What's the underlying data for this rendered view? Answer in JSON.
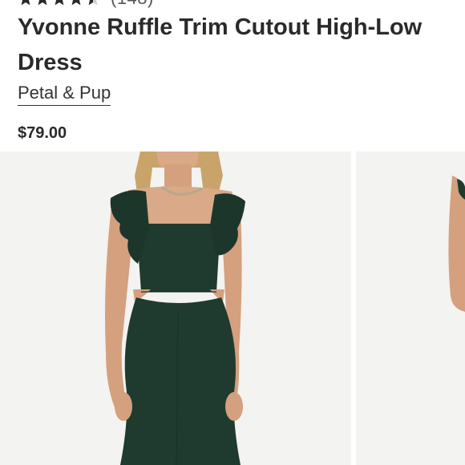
{
  "product": {
    "rating_stars": 4.5,
    "rating_count": "(148)",
    "title": "Yvonne Ruffle Trim Cutout High-Low Dress",
    "brand": "Petal & Pup",
    "price": "$79.00"
  },
  "gallery": {
    "images": [
      {
        "name": "product-photo-1"
      },
      {
        "name": "product-photo-2"
      }
    ]
  },
  "colors": {
    "text": "#2a2a2a",
    "photo_background": "#f3f3f1",
    "dress": "#1f3b2f",
    "star": "#2a2a2a"
  }
}
